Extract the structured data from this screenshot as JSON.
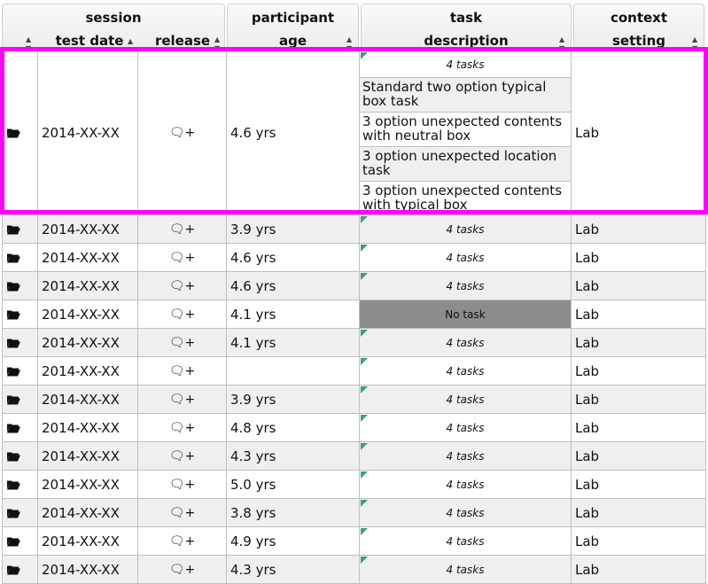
{
  "header": {
    "session": "session",
    "test_date": "test date",
    "release": "release",
    "participant": "participant",
    "age": "age",
    "task": "task",
    "description": "description",
    "context": "context",
    "setting": "setting"
  },
  "expanded_row": {
    "date": "2014-XX-XX",
    "age": "4.6 yrs",
    "tasks_count": "4 tasks",
    "subtasks": [
      "Standard two option typical box task",
      "3 option unexpected contents with neutral box",
      "3 option unexpected location task",
      "3 option unexpected contents with typical box"
    ],
    "setting": "Lab"
  },
  "rows": [
    {
      "date": "2014-XX-XX",
      "age": "3.9 yrs",
      "task": "4 tasks",
      "setting": "Lab"
    },
    {
      "date": "2014-XX-XX",
      "age": "4.6 yrs",
      "task": "4 tasks",
      "setting": "Lab"
    },
    {
      "date": "2014-XX-XX",
      "age": "4.6 yrs",
      "task": "4 tasks",
      "setting": "Lab"
    },
    {
      "date": "2014-XX-XX",
      "age": "4.1 yrs",
      "task": "No task",
      "setting": "Lab"
    },
    {
      "date": "2014-XX-XX",
      "age": "4.1 yrs",
      "task": "4 tasks",
      "setting": "Lab"
    },
    {
      "date": "2014-XX-XX",
      "age": "",
      "task": "4 tasks",
      "setting": "Lab"
    },
    {
      "date": "2014-XX-XX",
      "age": "3.9 yrs",
      "task": "4 tasks",
      "setting": "Lab"
    },
    {
      "date": "2014-XX-XX",
      "age": "4.8 yrs",
      "task": "4 tasks",
      "setting": "Lab"
    },
    {
      "date": "2014-XX-XX",
      "age": "4.3 yrs",
      "task": "4 tasks",
      "setting": "Lab"
    },
    {
      "date": "2014-XX-XX",
      "age": "5.0 yrs",
      "task": "4 tasks",
      "setting": "Lab"
    },
    {
      "date": "2014-XX-XX",
      "age": "3.8 yrs",
      "task": "4 tasks",
      "setting": "Lab"
    },
    {
      "date": "2014-XX-XX",
      "age": "4.9 yrs",
      "task": "4 tasks",
      "setting": "Lab"
    },
    {
      "date": "2014-XX-XX",
      "age": "4.3 yrs",
      "task": "4 tasks",
      "setting": "Lab"
    }
  ],
  "icons": {
    "folder": "folder-open-icon",
    "release": "comment-add-icon",
    "sort": "sort-arrows-icon"
  },
  "colors": {
    "highlight": "#ff00ff",
    "row_alt": "#efefef",
    "no_task_bg": "#8c8c8c",
    "task_marker": "#3aa07a"
  }
}
